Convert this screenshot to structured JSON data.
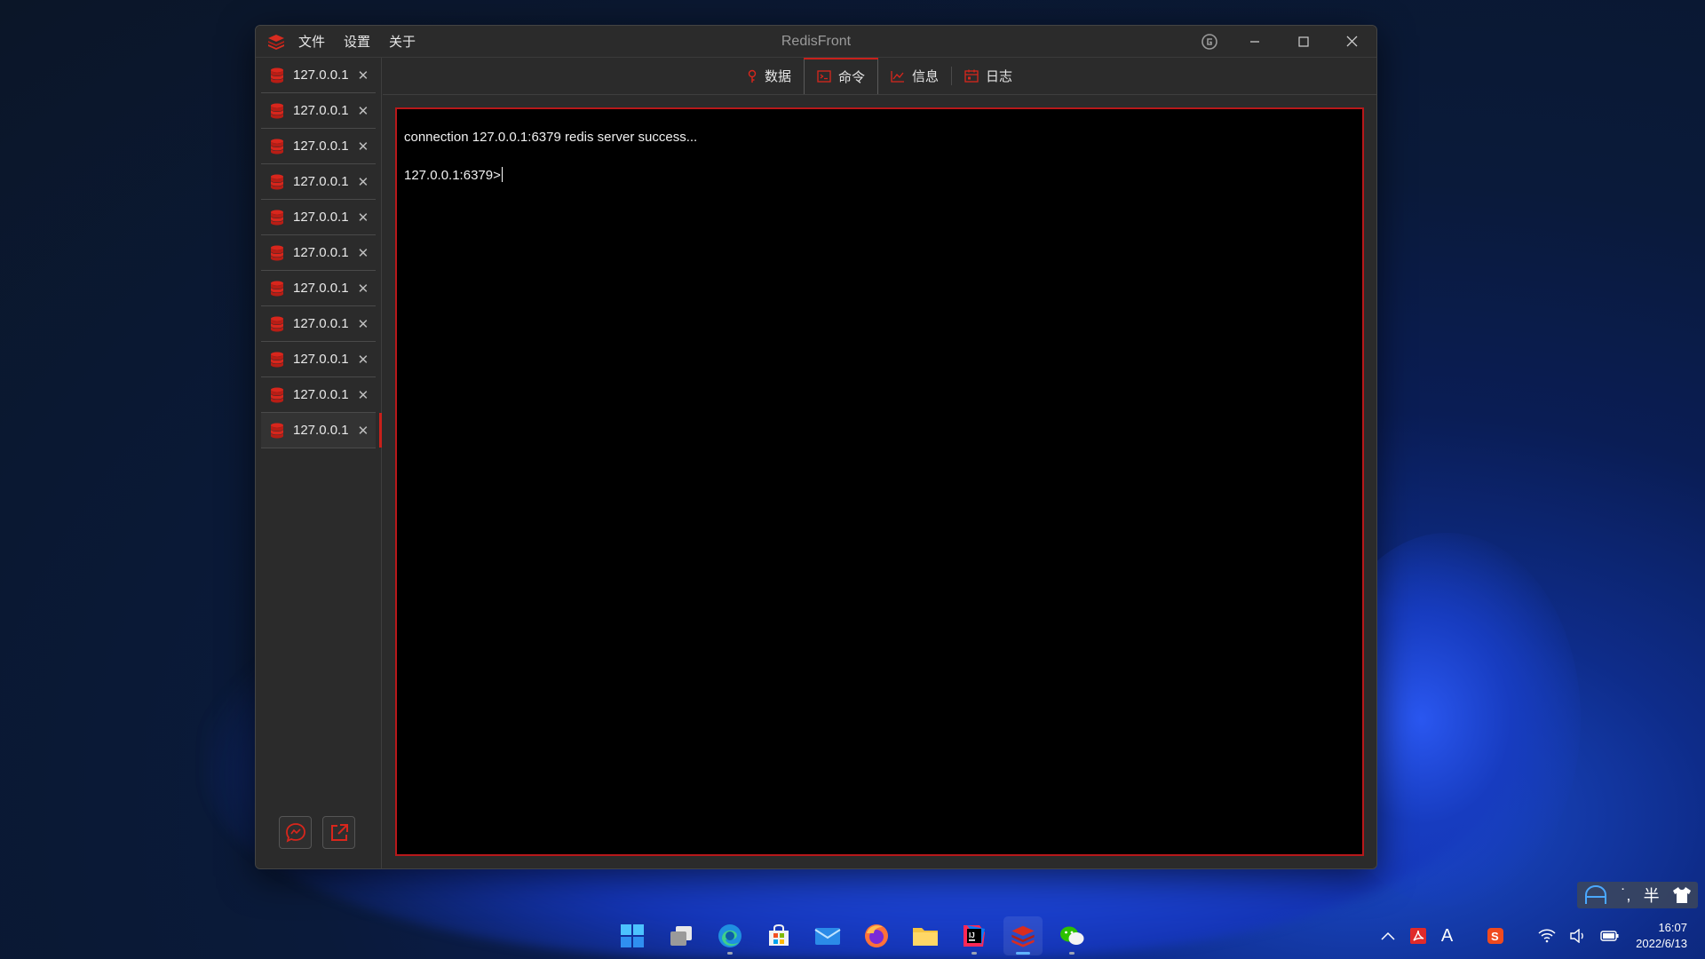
{
  "window": {
    "title": "RedisFront",
    "menu": [
      "文件",
      "设置",
      "关于"
    ]
  },
  "connections": [
    {
      "label": "127.0.0.1"
    },
    {
      "label": "127.0.0.1"
    },
    {
      "label": "127.0.0.1"
    },
    {
      "label": "127.0.0.1"
    },
    {
      "label": "127.0.0.1"
    },
    {
      "label": "127.0.0.1"
    },
    {
      "label": "127.0.0.1"
    },
    {
      "label": "127.0.0.1"
    },
    {
      "label": "127.0.0.1"
    },
    {
      "label": "127.0.0.1"
    },
    {
      "label": "127.0.0.1",
      "active": true
    }
  ],
  "close_glyph": "✕",
  "tabs": [
    {
      "label": "数据",
      "icon": "key-icon"
    },
    {
      "label": "命令",
      "icon": "terminal-icon",
      "active": true
    },
    {
      "label": "信息",
      "icon": "chart-icon"
    },
    {
      "label": "日志",
      "icon": "calendar-icon"
    }
  ],
  "terminal": {
    "line1": "connection 127.0.0.1:6379 redis server success...",
    "prompt": "127.0.0.1:6379>"
  },
  "taskbar": {
    "clock_time": "16:07",
    "clock_date": "2022/6/13",
    "ime": {
      "mode": "半"
    },
    "tray_font_glyph": "A"
  },
  "colors": {
    "accent": "#c8201b",
    "terminal_bg": "#000000",
    "window_bg": "#2b2b2b"
  }
}
